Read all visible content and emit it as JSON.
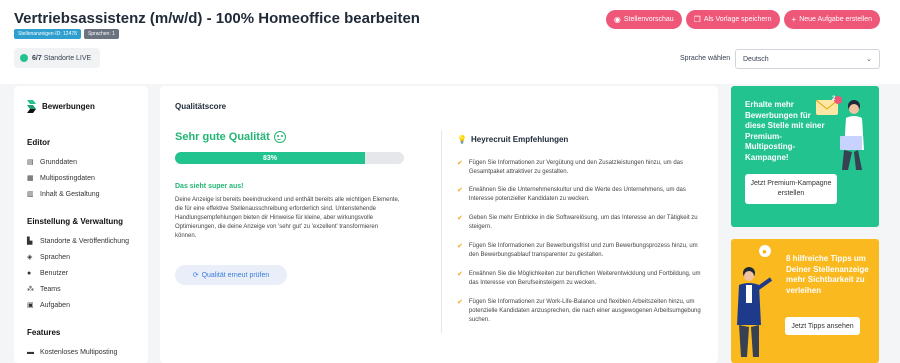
{
  "header": {
    "title": "Vertriebsassistenz (m/w/d) - 100% Homeoffice bearbeiten",
    "badge_id": "Stellenanzeigen-ID: 12478",
    "badge_lang": "Sprachen: 1",
    "actions": [
      {
        "label": "Stellenvorschau",
        "icon": "eye-icon"
      },
      {
        "label": "Als Vorlage speichern",
        "icon": "copy-icon"
      },
      {
        "label": "Neue Aufgabe erstellen",
        "icon": "plus-icon"
      }
    ],
    "locations_count": "6/7",
    "locations_label": "Standorte LIVE",
    "language_label": "Sprache wählen",
    "language_value": "Deutsch"
  },
  "sidebar": {
    "brand": "Bewerbungen",
    "sections": [
      {
        "title": "Editor",
        "items": [
          "Grunddaten",
          "Multipostingdaten",
          "Inhalt & Gestaltung"
        ]
      },
      {
        "title": "Einstellung & Verwaltung",
        "items": [
          "Standorte & Veröffentlichung",
          "Sprachen",
          "Benutzer",
          "Teams",
          "Aufgaben"
        ]
      },
      {
        "title": "Features",
        "items": [
          "Kostenloses Multiposting"
        ]
      }
    ]
  },
  "quality": {
    "title": "Qualitätscore",
    "label": "Sehr gute Qualität",
    "percent_text": "83%",
    "percent": 83,
    "subheading": "Das sieht super aus!",
    "description": "Deine Anzeige ist bereits beeindruckend und enthält bereits alle wichtigen Elemente, die für eine effektive Stellenausschreibung erforderlich sind. Untenstehende Handlungsempfehlungen bieten dir Hinweise für kleine, aber wirkungsvolle Optimierungen, die deine Anzeige von 'sehr gut' zu 'exzellent' transformieren können.",
    "recheck_button": "Qualität erneut prüfen"
  },
  "recommendations": {
    "title": "Heyrecruit Empfehlungen",
    "items": [
      "Fügen Sie Informationen zur Vergütung und den Zusatzleistungen hinzu, um das Gesamtpaket attraktiver zu gestalten.",
      "Erwähnen Sie die Unternehmenskultur und die Werte des Unternehmens, um das Interesse potenzieller Kandidaten zu wecken.",
      "Geben Sie mehr Einblicke in die Softwarelösung, um das Interesse an der Tätigkeit zu steigern.",
      "Fügen Sie Informationen zur Bewerbungsfrist und zum Bewerbungsprozess hinzu, um den Bewerbungsablauf transparenter zu gestalten.",
      "Erwähnen Sie die Möglichkeiten zur beruflichen Weiterentwicklung und Fortbildung, um das Interesse von Berufseinsteigern zu wecken.",
      "Fügen Sie Informationen zur Work-Life-Balance und flexiblen Arbeitszeiten hinzu, um potenzielle Kandidaten anzusprechen, die nach einer ausgewogenen Arbeitsumgebung suchen."
    ]
  },
  "promo_premium": {
    "text": "Erhalte mehr Bewerbungen für diese Stelle mit einer Premium-Multiposting-Kampagne!",
    "button": "Jetzt Premium-Kampagne erstellen",
    "notification_count": "2"
  },
  "promo_tips": {
    "text": "8 hilfreiche Tipps um Deiner Stellenanzeige mehr Sichtbarkeit zu verleihen",
    "button": "Jetzt Tipps ansehen"
  },
  "colors": {
    "accent_pink": "#ef5779",
    "quality_green": "#22c38e",
    "promo_yellow": "#f9b91f",
    "check_orange": "#f5a623"
  }
}
